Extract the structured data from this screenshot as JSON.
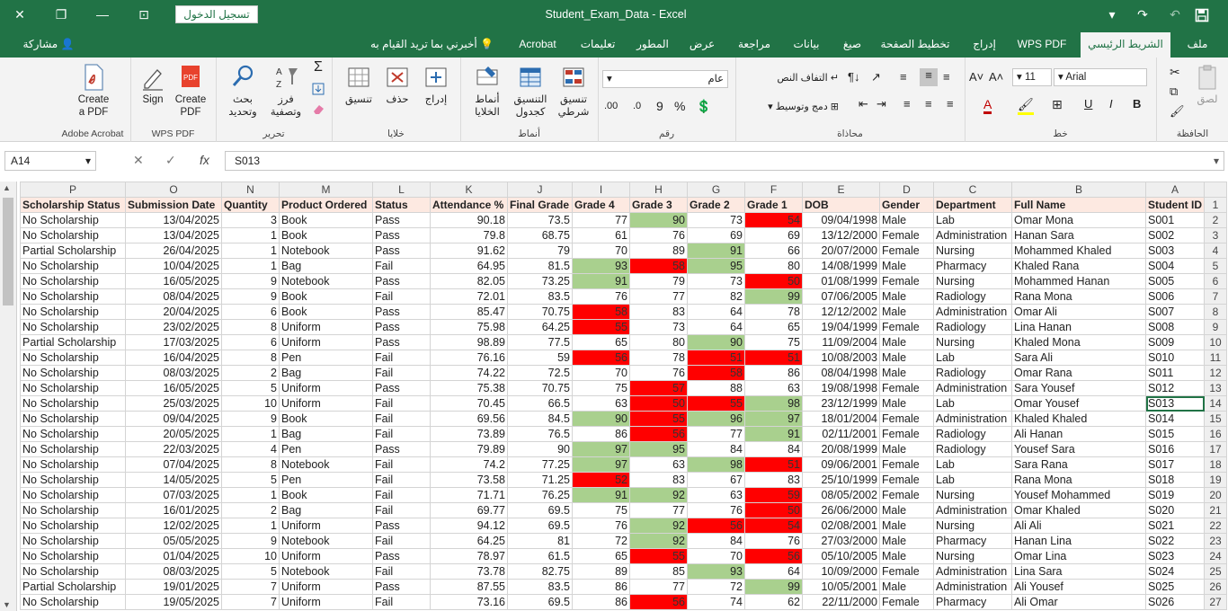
{
  "title_bar": {
    "doc_title": "Student_Exam_Data  -  Excel",
    "sign_in": "تسجيل الدخول",
    "close_glyph": "✕",
    "restore_glyph": "❐",
    "minimize_glyph": "—",
    "ribbon_display_glyph": "⊡",
    "save_glyph": "💾",
    "undo_glyph": "↶",
    "redo_glyph": "↷",
    "customize_glyph": "▾"
  },
  "tabs": {
    "file": "ملف",
    "home": "الشريط الرئيسي",
    "wps_pdf": "WPS PDF",
    "insert": "إدراج",
    "page_layout": "تخطيط الصفحة",
    "formulas": "صيغ",
    "data": "بيانات",
    "review": "مراجعة",
    "view": "عرض",
    "developer": "المطور",
    "help": "تعليمات",
    "acrobat": "Acrobat",
    "tell_me": "أخبرني بما تريد القيام به",
    "share": "مشاركة"
  },
  "ribbon": {
    "clipboard": {
      "label": "الحافظة",
      "paste": "لصق"
    },
    "font": {
      "label": "خط",
      "name": "Arial",
      "size": "11"
    },
    "alignment": {
      "label": "محاذاة",
      "wrap": "التفاف النص",
      "merge": "دمج وتوسيط"
    },
    "number": {
      "label": "رقم",
      "format": "عام",
      "percent": "%",
      "comma": "9"
    },
    "styles": {
      "label": "أنماط",
      "conditional": "تنسيق شرطي",
      "table": "التنسيق كجدول",
      "cell_styles": "أنماط الخلايا"
    },
    "cells": {
      "label": "خلايا",
      "insert": "إدراج",
      "delete": "حذف",
      "format": "تنسيق"
    },
    "editing": {
      "label": "تحرير",
      "sort": "فرز وتصفية",
      "find": "بحث وتحديد"
    },
    "wps": {
      "label": "WPS PDF",
      "sign": "Sign",
      "create": "Create PDF"
    },
    "adobe": {
      "label": "Adobe Acrobat",
      "create": "Create a PDF"
    }
  },
  "formula_bar": {
    "name_box": "A14",
    "cancel": "✕",
    "enter": "✓",
    "fx": "fx",
    "value": "S013"
  },
  "columns": [
    "P",
    "O",
    "N",
    "M",
    "L",
    "K",
    "J",
    "I",
    "H",
    "G",
    "F",
    "E",
    "D",
    "C",
    "B",
    "A"
  ],
  "headers": [
    "Scholarship Status",
    "Submission Date",
    "Quantity",
    "Product Ordered",
    "Status",
    "Attendance %",
    "Final Grade",
    "Grade 4",
    "Grade 3",
    "Grade 2",
    "Grade 1",
    "DOB",
    "Gender",
    "Department",
    "Full Name",
    "Student ID"
  ],
  "rows": [
    [
      "No Scholarship",
      "13/04/2025",
      "3",
      "Book",
      "Pass",
      "90.18",
      "73.5",
      "77",
      "90",
      "73",
      "54",
      "09/04/1998",
      "Male",
      "Lab",
      "Omar Mona",
      "S001"
    ],
    [
      "No Scholarship",
      "13/04/2025",
      "1",
      "Book",
      "Pass",
      "79.8",
      "68.75",
      "61",
      "76",
      "69",
      "69",
      "13/12/2000",
      "Female",
      "Administration",
      "Hanan Sara",
      "S002"
    ],
    [
      "Partial Scholarship",
      "26/04/2025",
      "1",
      "Notebook",
      "Pass",
      "91.62",
      "79",
      "70",
      "89",
      "91",
      "66",
      "20/07/2000",
      "Female",
      "Nursing",
      "Mohammed Khaled",
      "S003"
    ],
    [
      "No Scholarship",
      "10/04/2025",
      "1",
      "Bag",
      "Fail",
      "64.95",
      "81.5",
      "93",
      "58",
      "95",
      "80",
      "14/08/1999",
      "Male",
      "Pharmacy",
      "Khaled Rana",
      "S004"
    ],
    [
      "No Scholarship",
      "16/05/2025",
      "9",
      "Notebook",
      "Pass",
      "82.05",
      "73.25",
      "91",
      "79",
      "73",
      "50",
      "01/08/1999",
      "Female",
      "Nursing",
      "Mohammed Hanan",
      "S005"
    ],
    [
      "No Scholarship",
      "08/04/2025",
      "9",
      "Book",
      "Fail",
      "72.01",
      "83.5",
      "76",
      "77",
      "82",
      "99",
      "07/06/2005",
      "Male",
      "Radiology",
      "Rana Mona",
      "S006"
    ],
    [
      "No Scholarship",
      "20/04/2025",
      "6",
      "Book",
      "Pass",
      "85.47",
      "70.75",
      "58",
      "83",
      "64",
      "78",
      "12/12/2002",
      "Male",
      "Administration",
      "Omar Ali",
      "S007"
    ],
    [
      "No Scholarship",
      "23/02/2025",
      "8",
      "Uniform",
      "Pass",
      "75.98",
      "64.25",
      "55",
      "73",
      "64",
      "65",
      "19/04/1999",
      "Female",
      "Radiology",
      "Lina Hanan",
      "S008"
    ],
    [
      "Partial Scholarship",
      "17/03/2025",
      "6",
      "Uniform",
      "Pass",
      "98.89",
      "77.5",
      "65",
      "80",
      "90",
      "75",
      "11/09/2004",
      "Male",
      "Nursing",
      "Khaled Mona",
      "S009"
    ],
    [
      "No Scholarship",
      "16/04/2025",
      "8",
      "Pen",
      "Fail",
      "76.16",
      "59",
      "56",
      "78",
      "51",
      "51",
      "10/08/2003",
      "Male",
      "Lab",
      "Sara Ali",
      "S010"
    ],
    [
      "No Scholarship",
      "08/03/2025",
      "2",
      "Bag",
      "Fail",
      "74.22",
      "72.5",
      "70",
      "76",
      "58",
      "86",
      "08/04/1998",
      "Male",
      "Radiology",
      "Omar Rana",
      "S011"
    ],
    [
      "No Scholarship",
      "16/05/2025",
      "5",
      "Uniform",
      "Pass",
      "75.38",
      "70.75",
      "75",
      "57",
      "88",
      "63",
      "19/08/1998",
      "Female",
      "Administration",
      "Sara Yousef",
      "S012"
    ],
    [
      "No Scholarship",
      "25/03/2025",
      "10",
      "Uniform",
      "Fail",
      "70.45",
      "66.5",
      "63",
      "50",
      "55",
      "98",
      "23/12/1999",
      "Male",
      "Lab",
      "Omar Yousef",
      "S013"
    ],
    [
      "No Scholarship",
      "09/04/2025",
      "9",
      "Book",
      "Fail",
      "69.56",
      "84.5",
      "90",
      "55",
      "96",
      "97",
      "18/01/2004",
      "Female",
      "Administration",
      "Khaled Khaled",
      "S014"
    ],
    [
      "No Scholarship",
      "20/05/2025",
      "1",
      "Bag",
      "Fail",
      "73.89",
      "76.5",
      "86",
      "56",
      "77",
      "91",
      "02/11/2001",
      "Female",
      "Radiology",
      "Ali Hanan",
      "S015"
    ],
    [
      "No Scholarship",
      "22/03/2025",
      "4",
      "Pen",
      "Pass",
      "79.89",
      "90",
      "97",
      "95",
      "84",
      "84",
      "20/08/1999",
      "Male",
      "Radiology",
      "Yousef Sara",
      "S016"
    ],
    [
      "No Scholarship",
      "07/04/2025",
      "8",
      "Notebook",
      "Fail",
      "74.2",
      "77.25",
      "97",
      "63",
      "98",
      "51",
      "09/06/2001",
      "Female",
      "Lab",
      "Sara Rana",
      "S017"
    ],
    [
      "No Scholarship",
      "14/05/2025",
      "5",
      "Pen",
      "Fail",
      "73.58",
      "71.25",
      "52",
      "83",
      "67",
      "83",
      "25/10/1999",
      "Female",
      "Lab",
      "Rana Mona",
      "S018"
    ],
    [
      "No Scholarship",
      "07/03/2025",
      "1",
      "Book",
      "Fail",
      "71.71",
      "76.25",
      "91",
      "92",
      "63",
      "59",
      "08/05/2002",
      "Female",
      "Nursing",
      "Yousef Mohammed",
      "S019"
    ],
    [
      "No Scholarship",
      "16/01/2025",
      "2",
      "Bag",
      "Fail",
      "69.77",
      "69.5",
      "75",
      "77",
      "76",
      "50",
      "26/06/2000",
      "Male",
      "Administration",
      "Omar Khaled",
      "S020"
    ],
    [
      "No Scholarship",
      "12/02/2025",
      "1",
      "Uniform",
      "Pass",
      "94.12",
      "69.5",
      "76",
      "92",
      "56",
      "54",
      "02/08/2001",
      "Male",
      "Nursing",
      "Ali Ali",
      "S021"
    ],
    [
      "No Scholarship",
      "05/05/2025",
      "9",
      "Notebook",
      "Fail",
      "64.25",
      "81",
      "72",
      "92",
      "84",
      "76",
      "27/03/2000",
      "Male",
      "Pharmacy",
      "Hanan Lina",
      "S022"
    ],
    [
      "No Scholarship",
      "01/04/2025",
      "10",
      "Uniform",
      "Pass",
      "78.97",
      "61.5",
      "65",
      "55",
      "70",
      "56",
      "05/10/2005",
      "Male",
      "Nursing",
      "Omar Lina",
      "S023"
    ],
    [
      "No Scholarship",
      "08/03/2025",
      "5",
      "Notebook",
      "Fail",
      "73.78",
      "82.75",
      "89",
      "85",
      "93",
      "64",
      "10/09/2000",
      "Female",
      "Administration",
      "Lina Sara",
      "S024"
    ],
    [
      "Partial Scholarship",
      "19/01/2025",
      "7",
      "Uniform",
      "Pass",
      "87.55",
      "83.5",
      "86",
      "77",
      "72",
      "99",
      "10/05/2001",
      "Male",
      "Administration",
      "Ali Yousef",
      "S025"
    ],
    [
      "No Scholarship",
      "19/05/2025",
      "7",
      "Uniform",
      "Fail",
      "73.16",
      "69.5",
      "86",
      "56",
      "74",
      "62",
      "22/11/2000",
      "Female",
      "Pharmacy",
      "Ali Omar",
      "S026"
    ]
  ],
  "row_numbers": [
    "1",
    "2",
    "3",
    "4",
    "5",
    "6",
    "7",
    "8",
    "9",
    "10",
    "11",
    "12",
    "13",
    "14",
    "15",
    "16",
    "17",
    "18",
    "19",
    "20",
    "21",
    "22",
    "23",
    "24",
    "25",
    "26",
    "27"
  ],
  "colors": {
    "accent": "#217346",
    "grade_low": "#ff0000",
    "grade_high": "#a9d08e",
    "header_fill": "#fde9e1"
  }
}
